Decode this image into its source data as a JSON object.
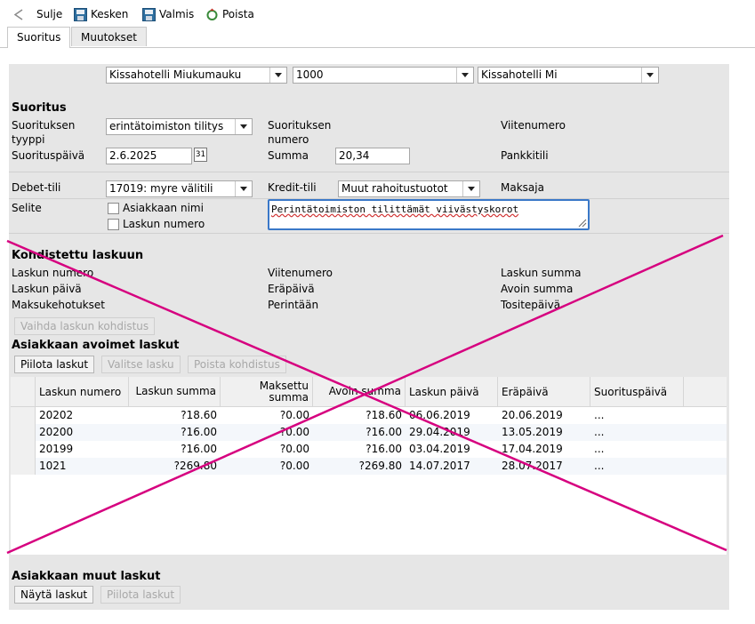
{
  "toolbar": {
    "back": "Sulje",
    "pause": "Kesken",
    "done": "Valmis",
    "delete": "Poista"
  },
  "tabs": [
    "Suoritus",
    "Muutokset"
  ],
  "top_selects": {
    "company": "Kissahotelli Miukumauku",
    "code": "1000",
    "name": "Kissahotelli Mi"
  },
  "suoritus": {
    "heading": "Suoritus",
    "type_label_1": "Suorituksen",
    "type_label_2": "tyyppi",
    "type_value": "erintätoimiston tilitys",
    "number_label_1": "Suorituksen",
    "number_label_2": "numero",
    "reference_label": "Viitenumero",
    "date_label": "Suorituspäivä",
    "date_value": "2.6.2025",
    "calendar_day": "31",
    "sum_label": "Summa",
    "sum_value": "20,34",
    "bank_label": "Pankkitili",
    "debit_label": "Debet-tili",
    "debit_value": "17019: myre välitili",
    "credit_label": "Kredit-tili",
    "credit_value": "Muut rahoitustuotot",
    "payer_label": "Maksaja",
    "note_label": "Selite",
    "chk_customer_name": "Asiakkaan nimi",
    "chk_invoice_number": "Laskun numero",
    "note_value": "Perintätoimiston tilittämät viivästyskorot"
  },
  "kohdistettu": {
    "heading": "Kohdistettu laskuun",
    "invoice_number": "Laskun numero",
    "reference": "Viitenumero",
    "invoice_sum": "Laskun summa",
    "invoice_date": "Laskun päivä",
    "due_date": "Eräpäivä",
    "open_sum": "Avoin summa",
    "payment_events": "Maksukehotukset",
    "collected": "Perintään",
    "voucher_date": "Tositepäivä",
    "change_button": "Vaihda laskun kohdistus"
  },
  "open_invoices": {
    "heading": "Asiakkaan avoimet laskut",
    "hide_button": "Piilota laskut",
    "select_button": "Valitse lasku",
    "remove_button": "Poista kohdistus",
    "columns": [
      "Laskun numero",
      "Laskun summa",
      "Maksettu summa",
      "Avoin summa",
      "Laskun päivä",
      "Eräpäivä",
      "Suorituspäivä"
    ],
    "rows": [
      [
        "20202",
        "?18.60",
        "?0.00",
        "?18.60",
        "06.06.2019",
        "20.06.2019",
        "..."
      ],
      [
        "20200",
        "?16.00",
        "?0.00",
        "?16.00",
        "29.04.2019",
        "13.05.2019",
        "..."
      ],
      [
        "20199",
        "?16.00",
        "?0.00",
        "?16.00",
        "03.04.2019",
        "17.04.2019",
        "..."
      ],
      [
        "1021",
        "?269.80",
        "?0.00",
        "?269.80",
        "14.07.2017",
        "28.07.2017",
        "..."
      ]
    ]
  },
  "other_invoices": {
    "heading": "Asiakkaan muut laskut",
    "show_button": "Näytä laskut",
    "hide_button": "Piilota laskut"
  },
  "colors": {
    "overlay_cross": "#d6007f",
    "panel_bg": "#e6e6e6"
  }
}
